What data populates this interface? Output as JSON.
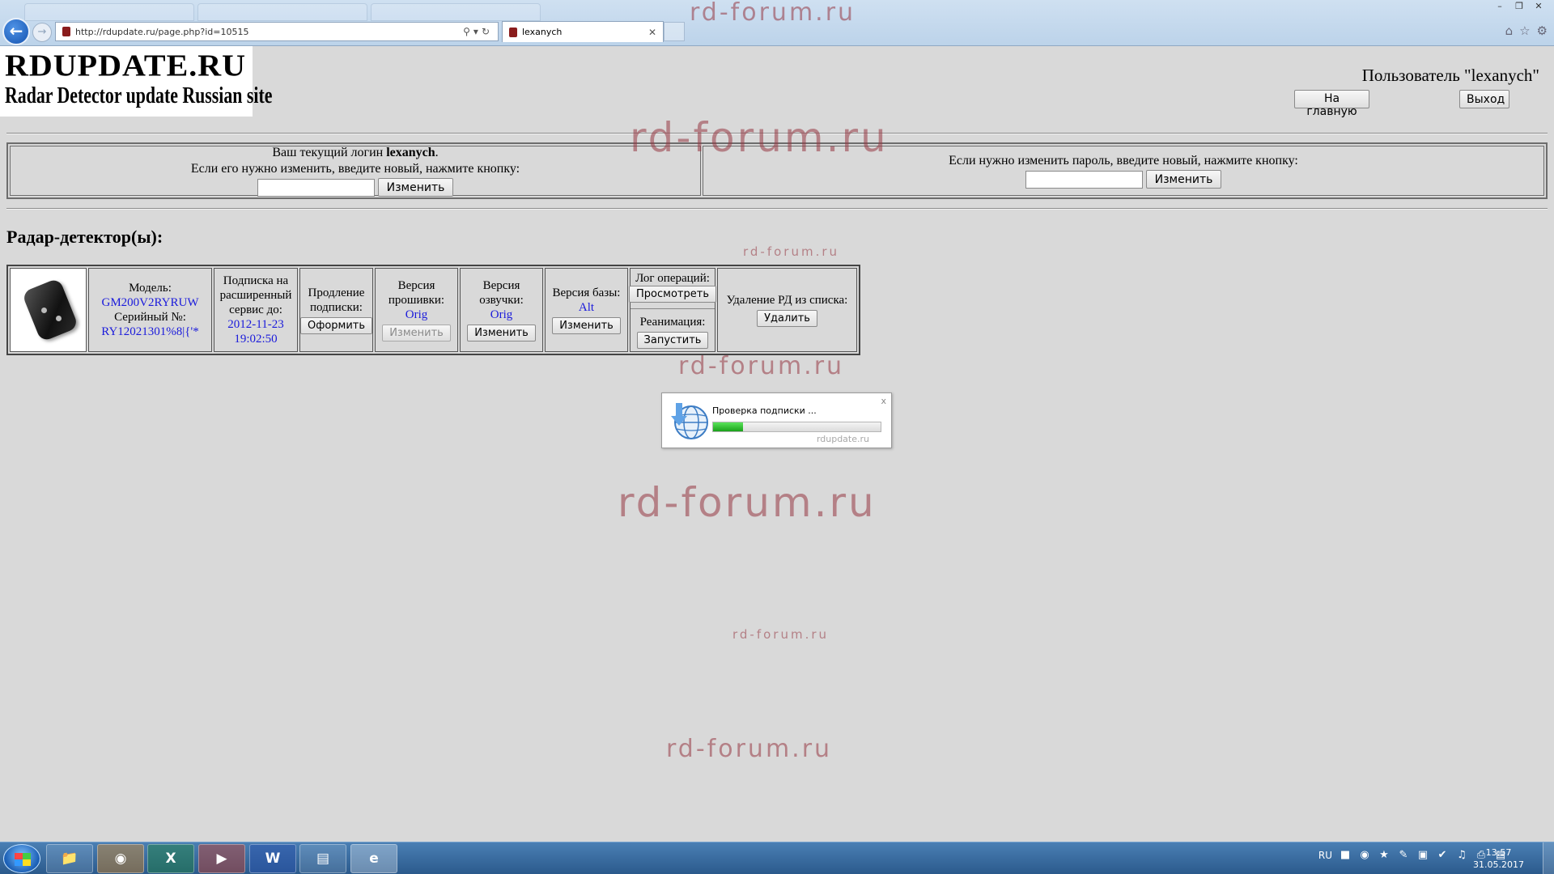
{
  "browser": {
    "url": "http://rdupdate.ru/page.php?id=10515",
    "tab_title": "lexanych",
    "window_controls": [
      "minimize-icon",
      "restore-icon",
      "close-icon"
    ],
    "toolbar_icons": [
      "home-icon",
      "star-icon",
      "gear-icon"
    ]
  },
  "header": {
    "logo_title": "RDUPDATE.RU",
    "logo_tagline": "Radar Detector update Russian site",
    "user_label": "Пользователь \"lexanych\"",
    "home_button": "На главную",
    "logout_button": "Выход"
  },
  "credentials": {
    "login_line1_prefix": "Ваш текущий логин ",
    "login_value": "lexanych",
    "login_line1_suffix": ".",
    "login_line2": "Если его нужно изменить, введите новый, нажмите кнопку:",
    "login_input_value": "",
    "login_change_button": "Изменить",
    "password_line": "Если нужно изменить пароль, введите новый, нажмите кнопку:",
    "password_input_value": "",
    "password_change_button": "Изменить"
  },
  "devices": {
    "section_title": "Радар-детектор(ы):",
    "row": {
      "model_label": "Модель:",
      "model_value": "GM200V2RYRUW",
      "serial_label": "Серийный №:",
      "serial_value": "RY12021301%8|{'*",
      "subscription_label": "Подписка на расширенный сервис до:",
      "subscription_date": "2012-11-23",
      "subscription_time": "19:02:50",
      "extend_label": "Продление подписки:",
      "extend_button": "Оформить",
      "firmware_label": "Версия прошивки:",
      "firmware_value": "Orig",
      "firmware_button": "Изменить",
      "voice_label": "Версия озвучки:",
      "voice_value": "Orig",
      "voice_button": "Изменить",
      "db_label": "Версия базы:",
      "db_value": "Alt",
      "db_button": "Изменить",
      "log_label": "Лог операций:",
      "log_button": "Просмотреть",
      "reanimation_label": "Реанимация:",
      "reanimation_button": "Запустить",
      "delete_label": "Удаление РД из списка:",
      "delete_button": "Удалить"
    }
  },
  "popup": {
    "message": "Проверка подписки ...",
    "progress_fraction": 0.18,
    "domain": "rdupdate.ru",
    "close": "x"
  },
  "watermarks": [
    "rd-forum.ru",
    "rd-forum.ru",
    "rd-forum.ru",
    "rd-forum.ru",
    "rd-forum.ru",
    "rd-forum.ru",
    "rd-forum.ru"
  ],
  "taskbar": {
    "apps": [
      "explorer-icon",
      "firefox-icon",
      "excel-icon",
      "player-icon",
      "word-icon",
      "document-icon",
      "ie-icon"
    ],
    "language": "RU",
    "time": "13:57",
    "date": "31.05.2017"
  }
}
